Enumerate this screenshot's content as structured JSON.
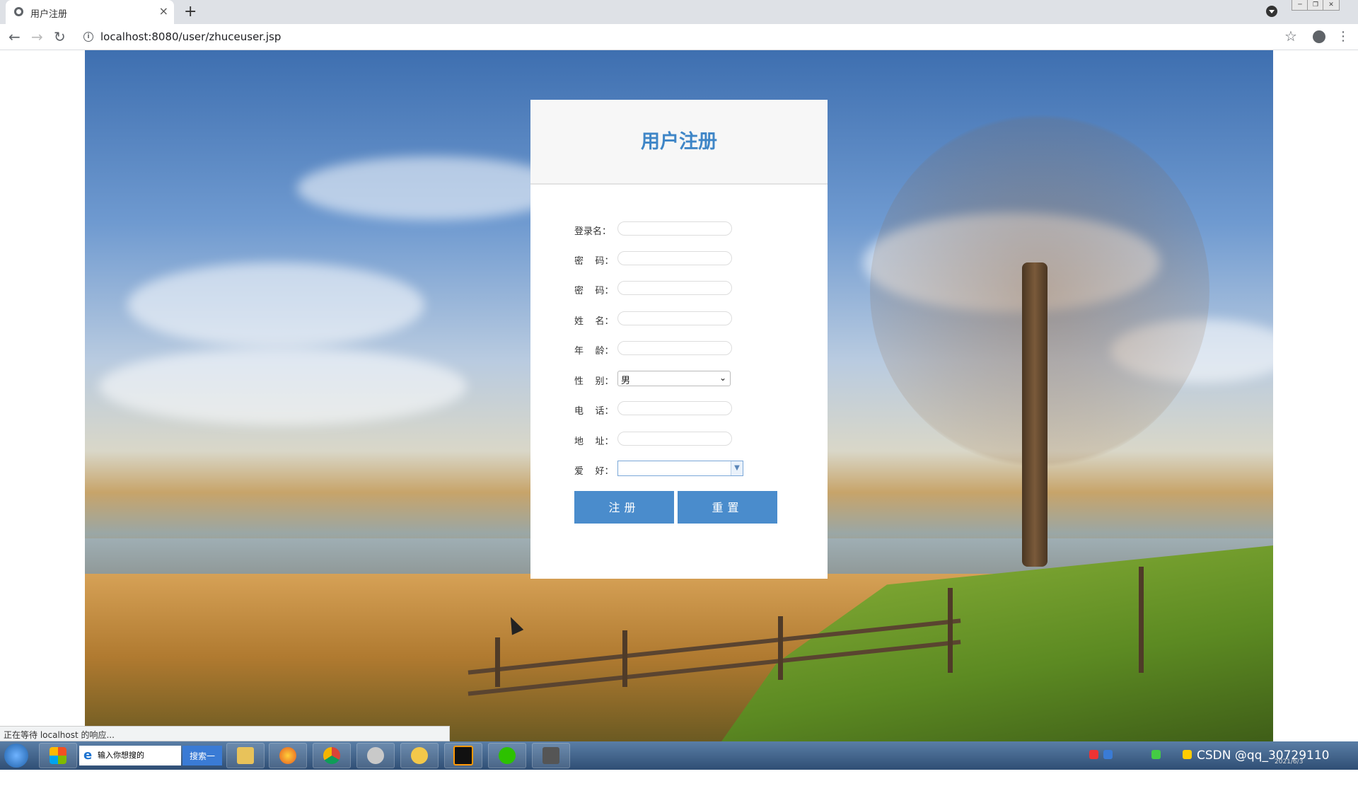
{
  "browser": {
    "tab_title": "用户注册",
    "tab_close": "×",
    "new_tab": "+",
    "url": "localhost:8080/user/zhuceuser.jsp",
    "status_text": "正在等待 localhost 的响应..."
  },
  "form": {
    "title": "用户注册",
    "fields": [
      {
        "label": "登录名：",
        "type": "text",
        "value": ""
      },
      {
        "label": "密    码：",
        "type": "password",
        "value": ""
      },
      {
        "label": "密    码：",
        "type": "password",
        "value": ""
      },
      {
        "label": "姓    名：",
        "type": "text",
        "value": ""
      },
      {
        "label": "年    龄：",
        "type": "text",
        "value": ""
      },
      {
        "label": "性    别：",
        "type": "select",
        "value": "男"
      },
      {
        "label": "电    话：",
        "type": "text",
        "value": ""
      },
      {
        "label": "地    址：",
        "type": "text",
        "value": ""
      },
      {
        "label": "爱    好：",
        "type": "multiselect",
        "value": ""
      }
    ],
    "submit_label": "注册",
    "reset_label": "重置"
  },
  "taskbar": {
    "search_placeholder": "输入你想搜的",
    "search_button": "搜索一下",
    "tray_watermark": "CSDN @qq_30729110",
    "tray_date": "2021/6/3",
    "ie_letter": "e"
  },
  "colors": {
    "accent": "#4a8ccc",
    "title": "#3f86c7"
  },
  "icons": {
    "back": "arrow-left",
    "forward": "arrow-right",
    "reload": "reload",
    "info": "info-circle",
    "star": "star",
    "account": "account-circle",
    "menu": "three-dots-vertical"
  }
}
